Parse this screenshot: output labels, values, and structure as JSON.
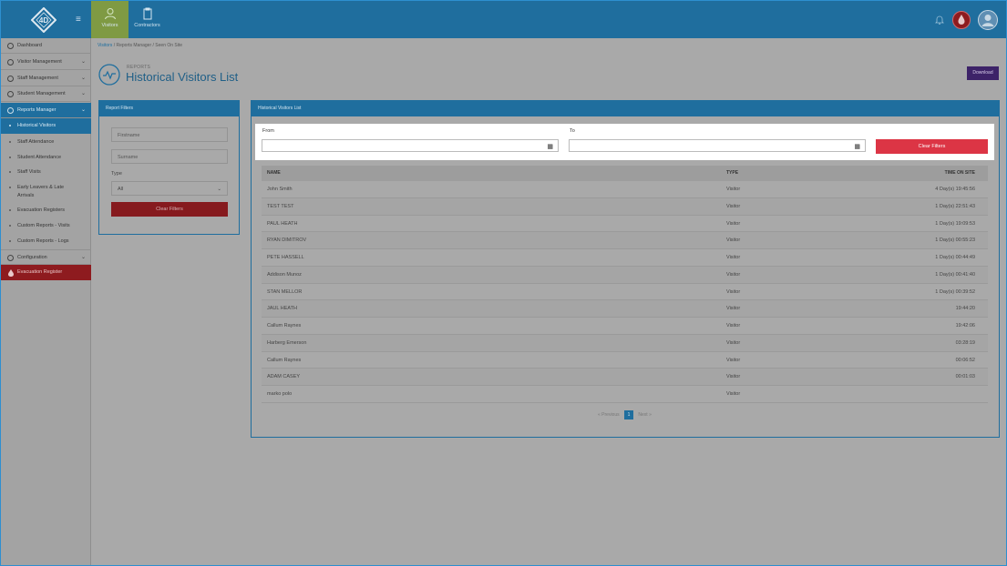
{
  "topnav": {
    "items": [
      {
        "label": "Visitors"
      },
      {
        "label": "Contractors"
      }
    ]
  },
  "sidebar": {
    "items": [
      {
        "label": "Dashboard"
      },
      {
        "label": "Visitor Management"
      },
      {
        "label": "Staff Management"
      },
      {
        "label": "Student Management"
      },
      {
        "label": "Reports Manager"
      }
    ],
    "sub_items": [
      {
        "label": "Historical Visitors"
      },
      {
        "label": "Staff Attendance"
      },
      {
        "label": "Student Attendance"
      },
      {
        "label": "Staff Visits"
      },
      {
        "label": "Early Leavers & Late"
      },
      {
        "label": "Arrivals"
      },
      {
        "label": "Evacuation Registers"
      },
      {
        "label": "Custom Reports - Visits"
      },
      {
        "label": "Custom Reports - Logs"
      }
    ],
    "configuration": "Configuration",
    "evacuation": "Evacuation Register"
  },
  "breadcrumb": {
    "items": [
      "Visitors",
      "Reports Manager",
      "Seen On Site"
    ],
    "sep": "/"
  },
  "page": {
    "sup": "REPORTS",
    "title": "Historical Visitors List",
    "download": "Download"
  },
  "filters_panel": {
    "title": "Report Filters",
    "firstname_placeholder": "Firstname",
    "surname_placeholder": "Surname",
    "type_label": "Type",
    "type_value": "All",
    "clear": "Clear Filters"
  },
  "list_panel": {
    "title": "Historical Visitors List",
    "from_label": "From",
    "to_label": "To",
    "clear": "Clear Filters"
  },
  "table": {
    "headers": [
      "NAME",
      "TYPE",
      "TIME ON SITE"
    ],
    "rows": [
      {
        "name": "John Smith",
        "type": "Visitor",
        "time": "4 Day(s) 19:45:56"
      },
      {
        "name": "TEST TEST",
        "type": "Visitor",
        "time": "1 Day(s) 22:51:43"
      },
      {
        "name": "PAUL HEATH",
        "type": "Visitor",
        "time": "1 Day(s) 19:09:53"
      },
      {
        "name": "RYAN DIMITROV",
        "type": "Visitor",
        "time": "1 Day(s) 00:55:23"
      },
      {
        "name": "PETE HASSELL",
        "type": "Visitor",
        "time": "1 Day(s) 00:44:49"
      },
      {
        "name": "Addison Munoz",
        "type": "Visitor",
        "time": "1 Day(s) 00:41:40"
      },
      {
        "name": "STAN MELLOR",
        "type": "Visitor",
        "time": "1 Day(s) 00:39:52"
      },
      {
        "name": "JAUL HEATH",
        "type": "Visitor",
        "time": "19:44:20"
      },
      {
        "name": "Callum Raynes",
        "type": "Visitor",
        "time": "19:42:06"
      },
      {
        "name": "Harberg Emerson",
        "type": "Visitor",
        "time": "03:28:19"
      },
      {
        "name": "Callum Raynes",
        "type": "Visitor",
        "time": "00:06:52"
      },
      {
        "name": "ADAM CASEY",
        "type": "Visitor",
        "time": "00:01:03"
      },
      {
        "name": "marko polo",
        "type": "Visitor",
        "time": ""
      }
    ]
  },
  "pager": {
    "previous": "« Previous",
    "page": "1",
    "next": "Next »"
  }
}
